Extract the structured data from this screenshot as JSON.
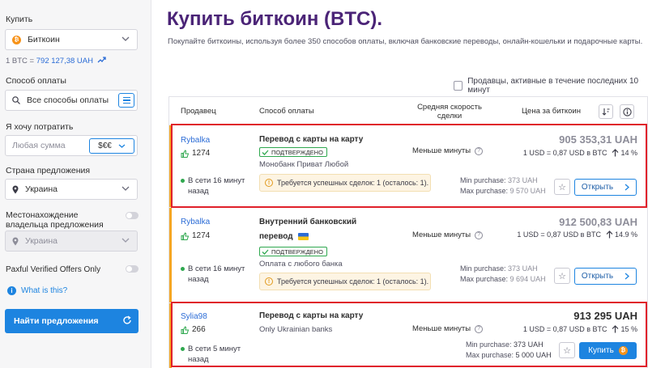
{
  "sidebar": {
    "buy_label": "Купить",
    "crypto_value": "Биткоин",
    "rate_prefix": "1 BTC = ",
    "rate_value": "792 127,38 UAH",
    "payment_label": "Способ оплаты",
    "payment_value": "Все способы оплаты",
    "spend_label": "Я хочу потратить",
    "spend_placeholder": "Любая сумма",
    "currency_button": "$€€",
    "country_label": "Страна предложения",
    "country_value": "Украина",
    "owner_location_label": "Местонахождение владельца предложения",
    "owner_location_value": "Украина",
    "verified_offers_label": "Paxful Verified Offers Only",
    "what_is_this": "What is this?",
    "find_button": "Найти предложения"
  },
  "main": {
    "title": "Купить биткоин (BTC).",
    "subtitle": "Покупайте биткоины, используя более 350 способов оплаты, включая банковские переводы, онлайн-кошельки и подарочные карты.",
    "active_sellers_label": "Продавцы, активные в течение последних 10 минут"
  },
  "table": {
    "headers": {
      "seller": "Продавец",
      "payment": "Способ оплаты",
      "speed": "Средняя скорость сделки",
      "price": "Цена за биткоин"
    },
    "offers": [
      {
        "seller": "Rybalka",
        "feedback": "1274",
        "online": "В сети 16 минут назад",
        "method": "Перевод с карты на карту",
        "verified": "ПОДТВЕРЖДЕНО",
        "details": "Монобанк Приват Любой",
        "warning": "Требуется успешных сделок: 1 (осталось: 1).",
        "speed": "Меньше минуты",
        "price": "905 353,31 UAH",
        "rate": "1 USD = 0,87 USD в BTC",
        "margin": "14 %",
        "min": "Min purchase:",
        "min_value": "373 UAH",
        "max": "Max purchase:",
        "max_value": "9 570 UAH",
        "action": "Открыть"
      },
      {
        "seller": "Rybalka",
        "feedback": "1274",
        "online": "В сети 16 минут назад",
        "method_line1": "Внутренний банковский",
        "method_line2": "перевод",
        "verified": "ПОДТВЕРЖДЕНО",
        "details": "Оплата с любого банка",
        "warning": "Требуется успешных сделок: 1 (осталось: 1).",
        "speed": "Меньше минуты",
        "price": "912 500,83 UAH",
        "rate": "1 USD = 0,87 USD в BTC",
        "margin": "14.9 %",
        "min": "Min purchase:",
        "min_value": "373 UAH",
        "max": "Max purchase:",
        "max_value": "9 694 UAH",
        "action": "Открыть"
      },
      {
        "seller": "Sylia98",
        "feedback": "266",
        "online": "В сети 5 минут назад",
        "method": "Перевод с карты на карту",
        "details": "Only Ukrainian banks",
        "speed": "Меньше минуты",
        "price": "913 295 UAH",
        "rate": "1 USD = 0,87 USD в BTC",
        "margin": "15 %",
        "min": "Min purchase:",
        "min_value": "373 UAH",
        "max": "Max purchase:",
        "max_value": "5 000 UAH",
        "action": "Купить"
      }
    ]
  },
  "colors": {
    "accent": "#1d84e0",
    "title": "#4b2477",
    "highlight": "#e0202a",
    "online": "#2fa84f",
    "bitcoin": "#f7931a"
  }
}
